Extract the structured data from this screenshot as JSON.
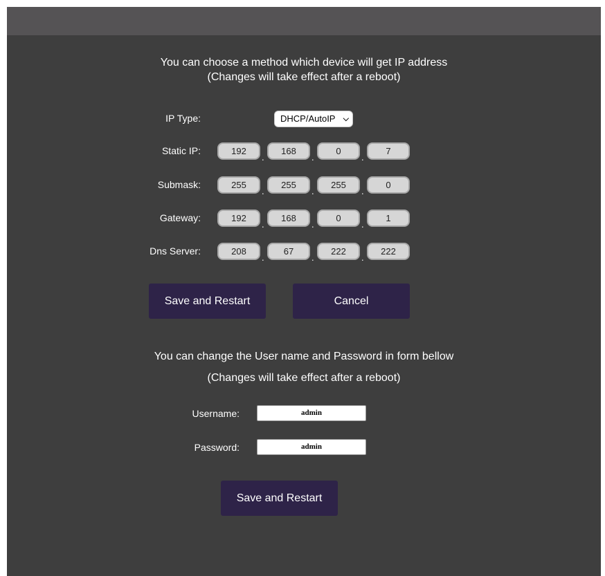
{
  "network": {
    "heading_line1": "You can choose a method which device will get IP address",
    "heading_line2": "(Changes will take effect after a reboot)",
    "ip_type": {
      "label": "IP Type:",
      "selected": "DHCP/AutoIP"
    },
    "static_ip": {
      "label": "Static IP:",
      "octets": [
        "192",
        "168",
        "0",
        "7"
      ]
    },
    "submask": {
      "label": "Submask:",
      "octets": [
        "255",
        "255",
        "255",
        "0"
      ]
    },
    "gateway": {
      "label": "Gateway:",
      "octets": [
        "192",
        "168",
        "0",
        "1"
      ]
    },
    "dns": {
      "label": "Dns Server:",
      "octets": [
        "208",
        "67",
        "222",
        "222"
      ]
    },
    "separator": ".",
    "save_label": "Save and Restart",
    "cancel_label": "Cancel"
  },
  "credentials": {
    "heading_line1": "You can change the User name and Password in form bellow",
    "heading_line2": "(Changes will take effect after a reboot)",
    "username_label": "Username:",
    "username_value": "admin",
    "password_label": "Password:",
    "password_value": "admin",
    "save_label": "Save and Restart"
  },
  "colors": {
    "panel": "#3e3e3e",
    "topbar": "#555355",
    "button": "#2e2348",
    "octet_fill": "#d6d6d6"
  }
}
